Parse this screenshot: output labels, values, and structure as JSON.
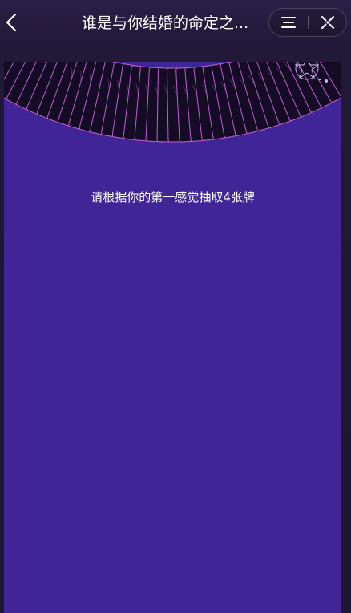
{
  "header": {
    "back_icon": "chevron-left-icon",
    "title": "谁是与你结婚的命定之...",
    "menu_icon": "three-lines-menu-icon",
    "close_icon": "close-target-icon"
  },
  "main": {
    "instruction": "请根据你的第一感觉抽取4张牌",
    "deck_icon": "tarot-card-deck"
  },
  "colors": {
    "page_background": "#241a3b",
    "panel_background": "#3f2595",
    "card_back": "#140c24",
    "card_edge": "#c45ad8"
  }
}
